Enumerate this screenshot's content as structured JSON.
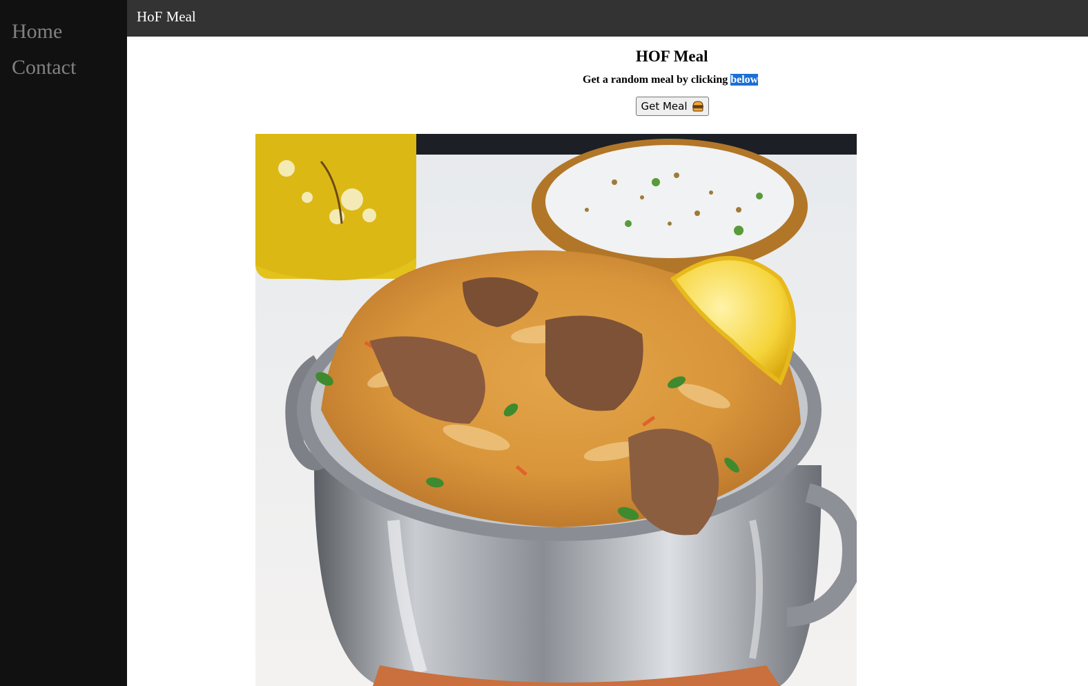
{
  "app": {
    "title": "HoF Meal"
  },
  "sidebar": {
    "items": [
      {
        "label": "Home"
      },
      {
        "label": "Contact"
      }
    ]
  },
  "main": {
    "heading": "HOF Meal",
    "subtitle_prefix": "Get a random meal by clicking ",
    "subtitle_highlight": "below",
    "button_label": "Get Meal",
    "button_icon": "burger-icon"
  },
  "colors": {
    "sidebar_bg": "#111111",
    "topbar_bg": "#333333",
    "nav_text": "#818181",
    "selection_highlight": "#1a6fd6"
  }
}
